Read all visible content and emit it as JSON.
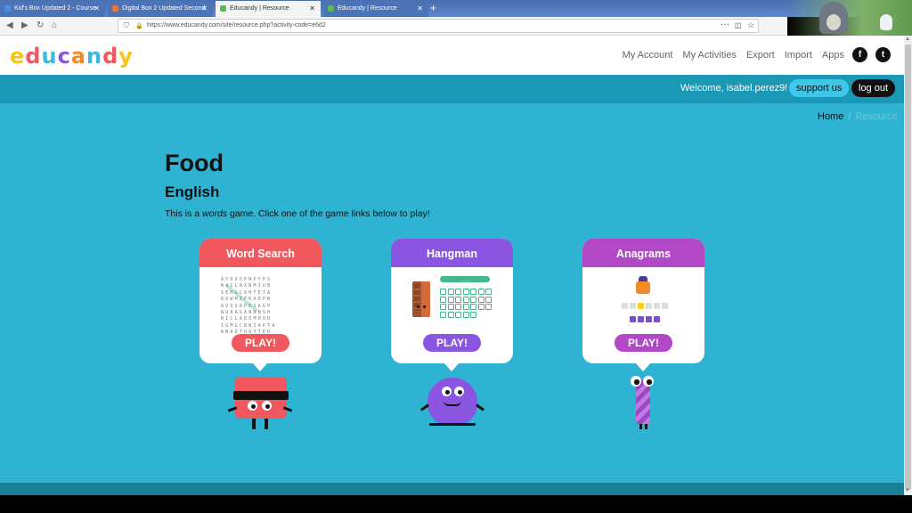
{
  "browser": {
    "tabs": [
      {
        "label": "Kid's Box Updated 2 - Course",
        "favicon": "#4a90e2"
      },
      {
        "label": "Digital Box 2 Updated Second",
        "favicon": "#e8743b"
      },
      {
        "label": "Educandy | Resource",
        "favicon": "#5cb85c"
      },
      {
        "label": "Educandy | Resource",
        "favicon": "#5cb85c"
      }
    ],
    "url": "https://www.educandy.com/site/resource.php?activity-code=e6d2",
    "icons": [
      "back-icon",
      "forward-icon",
      "reload-icon",
      "home-icon",
      "shield-icon",
      "lock-icon",
      "more-icon",
      "pocket-icon",
      "star-icon"
    ]
  },
  "header": {
    "logo": "educandy",
    "menu": [
      "My Account",
      "My Activities",
      "Export",
      "Import",
      "Apps"
    ],
    "social": [
      "facebook-icon",
      "twitter-icon"
    ]
  },
  "welcome": {
    "text": "Welcome, isabel.perez9!",
    "support": "support us",
    "logout": "log out"
  },
  "breadcrumb": {
    "home": "Home",
    "sep": "/",
    "current": "Resource"
  },
  "resource": {
    "title": "Food",
    "language": "English",
    "desc_pre": "This is a ",
    "desc_em": "words",
    "desc_post": " game. Click one of the game links below to play!"
  },
  "games": [
    {
      "name": "Word Search",
      "play": "PLAY!",
      "color": "#f0585d"
    },
    {
      "name": "Hangman",
      "play": "PLAY!",
      "color": "#8a55e0"
    },
    {
      "name": "Anagrams",
      "play": "PLAY!",
      "color": "#b348c7"
    }
  ]
}
